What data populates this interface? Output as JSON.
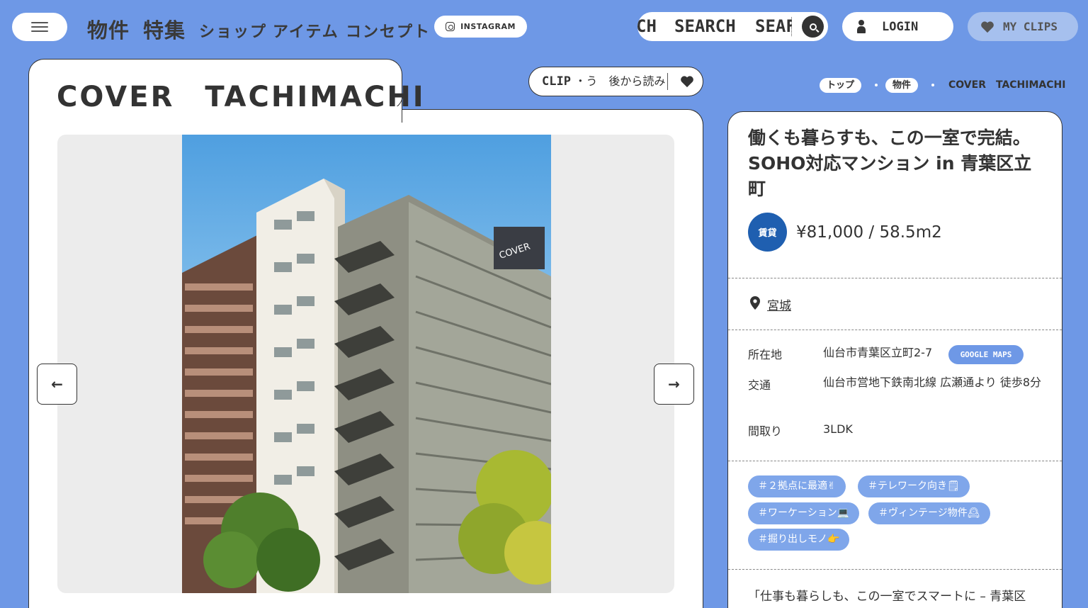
{
  "header": {
    "nav_primary": [
      "物件",
      "特集"
    ],
    "nav_secondary": [
      "ショップ",
      "アイテム",
      "コンセプト"
    ],
    "instagram_label": "INSTAGRAM",
    "search_words": [
      "CH",
      "SEARCH",
      "SEAF"
    ],
    "login_label": "LOGIN",
    "myclips_label": "MY CLIPS"
  },
  "page": {
    "title": "COVER　TACHIMACHI",
    "clip_label": "CLIP",
    "clip_marquee": "・う　後から読み"
  },
  "breadcrumb": {
    "top": "トップ",
    "property": "物件",
    "current": "COVER　TACHIMACHI"
  },
  "gallery": {
    "prev_arrow": "←",
    "next_arrow": "→",
    "sign_text": "COVER"
  },
  "property": {
    "heading": "働くも暮らすも、この一室で完結。SOHO対応マンション in 青葉区立町",
    "badge": "賃貸",
    "price": "¥81,000 / 58.5m2",
    "prefecture": "宮城",
    "address_label": "所在地",
    "address_value": "仙台市青葉区立町2-7",
    "maps_label": "GOOGLE MAPS",
    "access_label": "交通",
    "access_value": "仙台市営地下鉄南北線 広瀬通より 徒歩8分",
    "layout_label": "間取り",
    "layout_value": "3LDK",
    "tags": [
      "＃２拠点に最適✌",
      "＃テレワーク向き🗒",
      "＃ワーケーション💻",
      "＃ヴィンテージ物件🕰",
      "＃掘り出しモノ👉"
    ],
    "quote": "「仕事も暮らしも、この一室でスマートに – 青葉区"
  },
  "colors": {
    "background": "#6e98e6",
    "badge": "#1f5fb0",
    "tag": "#7fa6ea",
    "myclips": "#a6c0ee"
  }
}
